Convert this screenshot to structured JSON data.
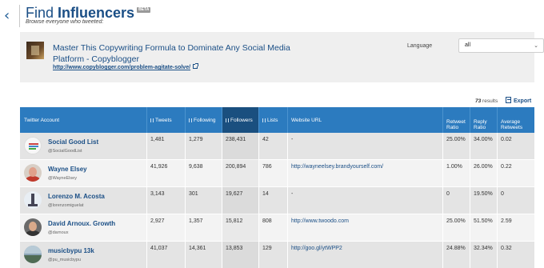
{
  "header": {
    "back_icon": "chevron-left-icon",
    "title_light": "Find ",
    "title_bold": "Influencers",
    "badge": "BETA",
    "subtitle": "Browse everyone who tweeted:"
  },
  "tweet": {
    "title": "Master This Copywriting Formula to Dominate Any Social Media Platform - Copyblogger",
    "link": "http://www.copyblogger.com/problem-agitate-solve/",
    "language_label": "Language",
    "language_value": "all"
  },
  "results": {
    "count": "73",
    "label": "results",
    "export_label": "Export"
  },
  "table": {
    "columns": [
      "Twitter Account",
      "Tweets",
      "Following",
      "Followers",
      "Lists",
      "Website URL",
      "Retweet Ratio",
      "Reply Ratio",
      "Average Retweets"
    ],
    "active_column": "Followers",
    "rows": [
      {
        "name": "Social Good List",
        "handle": "@SocialGoodList",
        "tweets": "1,481",
        "following": "1,279",
        "followers": "238,431",
        "lists": "42",
        "website": "-",
        "retweet_ratio": "25.00%",
        "reply_ratio": "34.00%",
        "avg_retweets": "0.02"
      },
      {
        "name": "Wayne Elsey",
        "handle": "@WayneElsey",
        "tweets": "41,926",
        "following": "9,638",
        "followers": "200,894",
        "lists": "786",
        "website": "http://wayneelsey.brandyourself.com/",
        "retweet_ratio": "1.00%",
        "reply_ratio": "26.00%",
        "avg_retweets": "0.22"
      },
      {
        "name": "Lorenzo M. Acosta",
        "handle": "@lorenzomiguelat",
        "tweets": "3,143",
        "following": "301",
        "followers": "19,627",
        "lists": "14",
        "website": "-",
        "retweet_ratio": "0",
        "reply_ratio": "19.50%",
        "avg_retweets": "0"
      },
      {
        "name": "David Arnoux. Growth",
        "handle": "@darnoux",
        "tweets": "2,927",
        "following": "1,357",
        "followers": "15,812",
        "lists": "808",
        "website": "http://www.twoodo.com",
        "retweet_ratio": "25.00%",
        "reply_ratio": "51.50%",
        "avg_retweets": "2.59"
      },
      {
        "name": "musicbypu 13k",
        "handle": "@pu_musicbypu",
        "tweets": "41,037",
        "following": "14,361",
        "followers": "13,853",
        "lists": "129",
        "website": "http://goo.gl/ytWPP2",
        "retweet_ratio": "24.88%",
        "reply_ratio": "32.34%",
        "avg_retweets": "0.32"
      }
    ]
  },
  "colors": {
    "header_blue": "#2c7bbf",
    "active_column": "#1a4f7f",
    "link_blue": "#1b4f86"
  }
}
